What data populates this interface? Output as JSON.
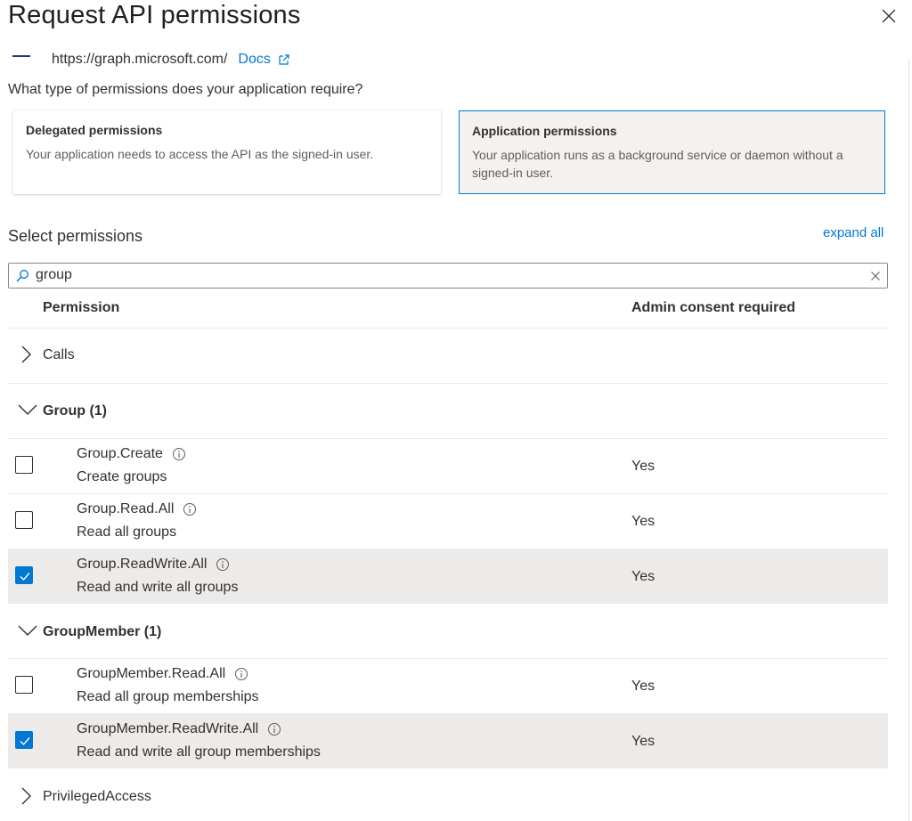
{
  "dialog": {
    "title": "Request API permissions"
  },
  "api": {
    "url": "https://graph.microsoft.com/",
    "docs_label": "Docs"
  },
  "question": "What type of permissions does your application require?",
  "permission_types": [
    {
      "title": "Delegated permissions",
      "description": "Your application needs to access the API as the signed-in user.",
      "selected": false
    },
    {
      "title": "Application permissions",
      "description": "Your application runs as a background service or daemon without a signed-in user.",
      "selected": true
    }
  ],
  "select": {
    "label": "Select permissions",
    "expand_all": "expand all",
    "search_value": "group"
  },
  "table": {
    "col_permission": "Permission",
    "col_admin": "Admin consent required"
  },
  "groups": [
    {
      "label": "Calls",
      "expanded": false
    },
    {
      "label": "Group (1)",
      "expanded": true,
      "items": [
        {
          "name": "Group.Create",
          "description": "Create groups",
          "admin": "Yes",
          "checked": false
        },
        {
          "name": "Group.Read.All",
          "description": "Read all groups",
          "admin": "Yes",
          "checked": false
        },
        {
          "name": "Group.ReadWrite.All",
          "description": "Read and write all groups",
          "admin": "Yes",
          "checked": true
        }
      ]
    },
    {
      "label": "GroupMember (1)",
      "expanded": true,
      "items": [
        {
          "name": "GroupMember.Read.All",
          "description": "Read all group memberships",
          "admin": "Yes",
          "checked": false
        },
        {
          "name": "GroupMember.ReadWrite.All",
          "description": "Read and write all group memberships",
          "admin": "Yes",
          "checked": true
        }
      ]
    },
    {
      "label": "PrivilegedAccess",
      "expanded": false
    }
  ],
  "colors": {
    "accent": "#0078d4",
    "selected_row": "#edebe9",
    "selected_card": "#f3f2f1"
  }
}
